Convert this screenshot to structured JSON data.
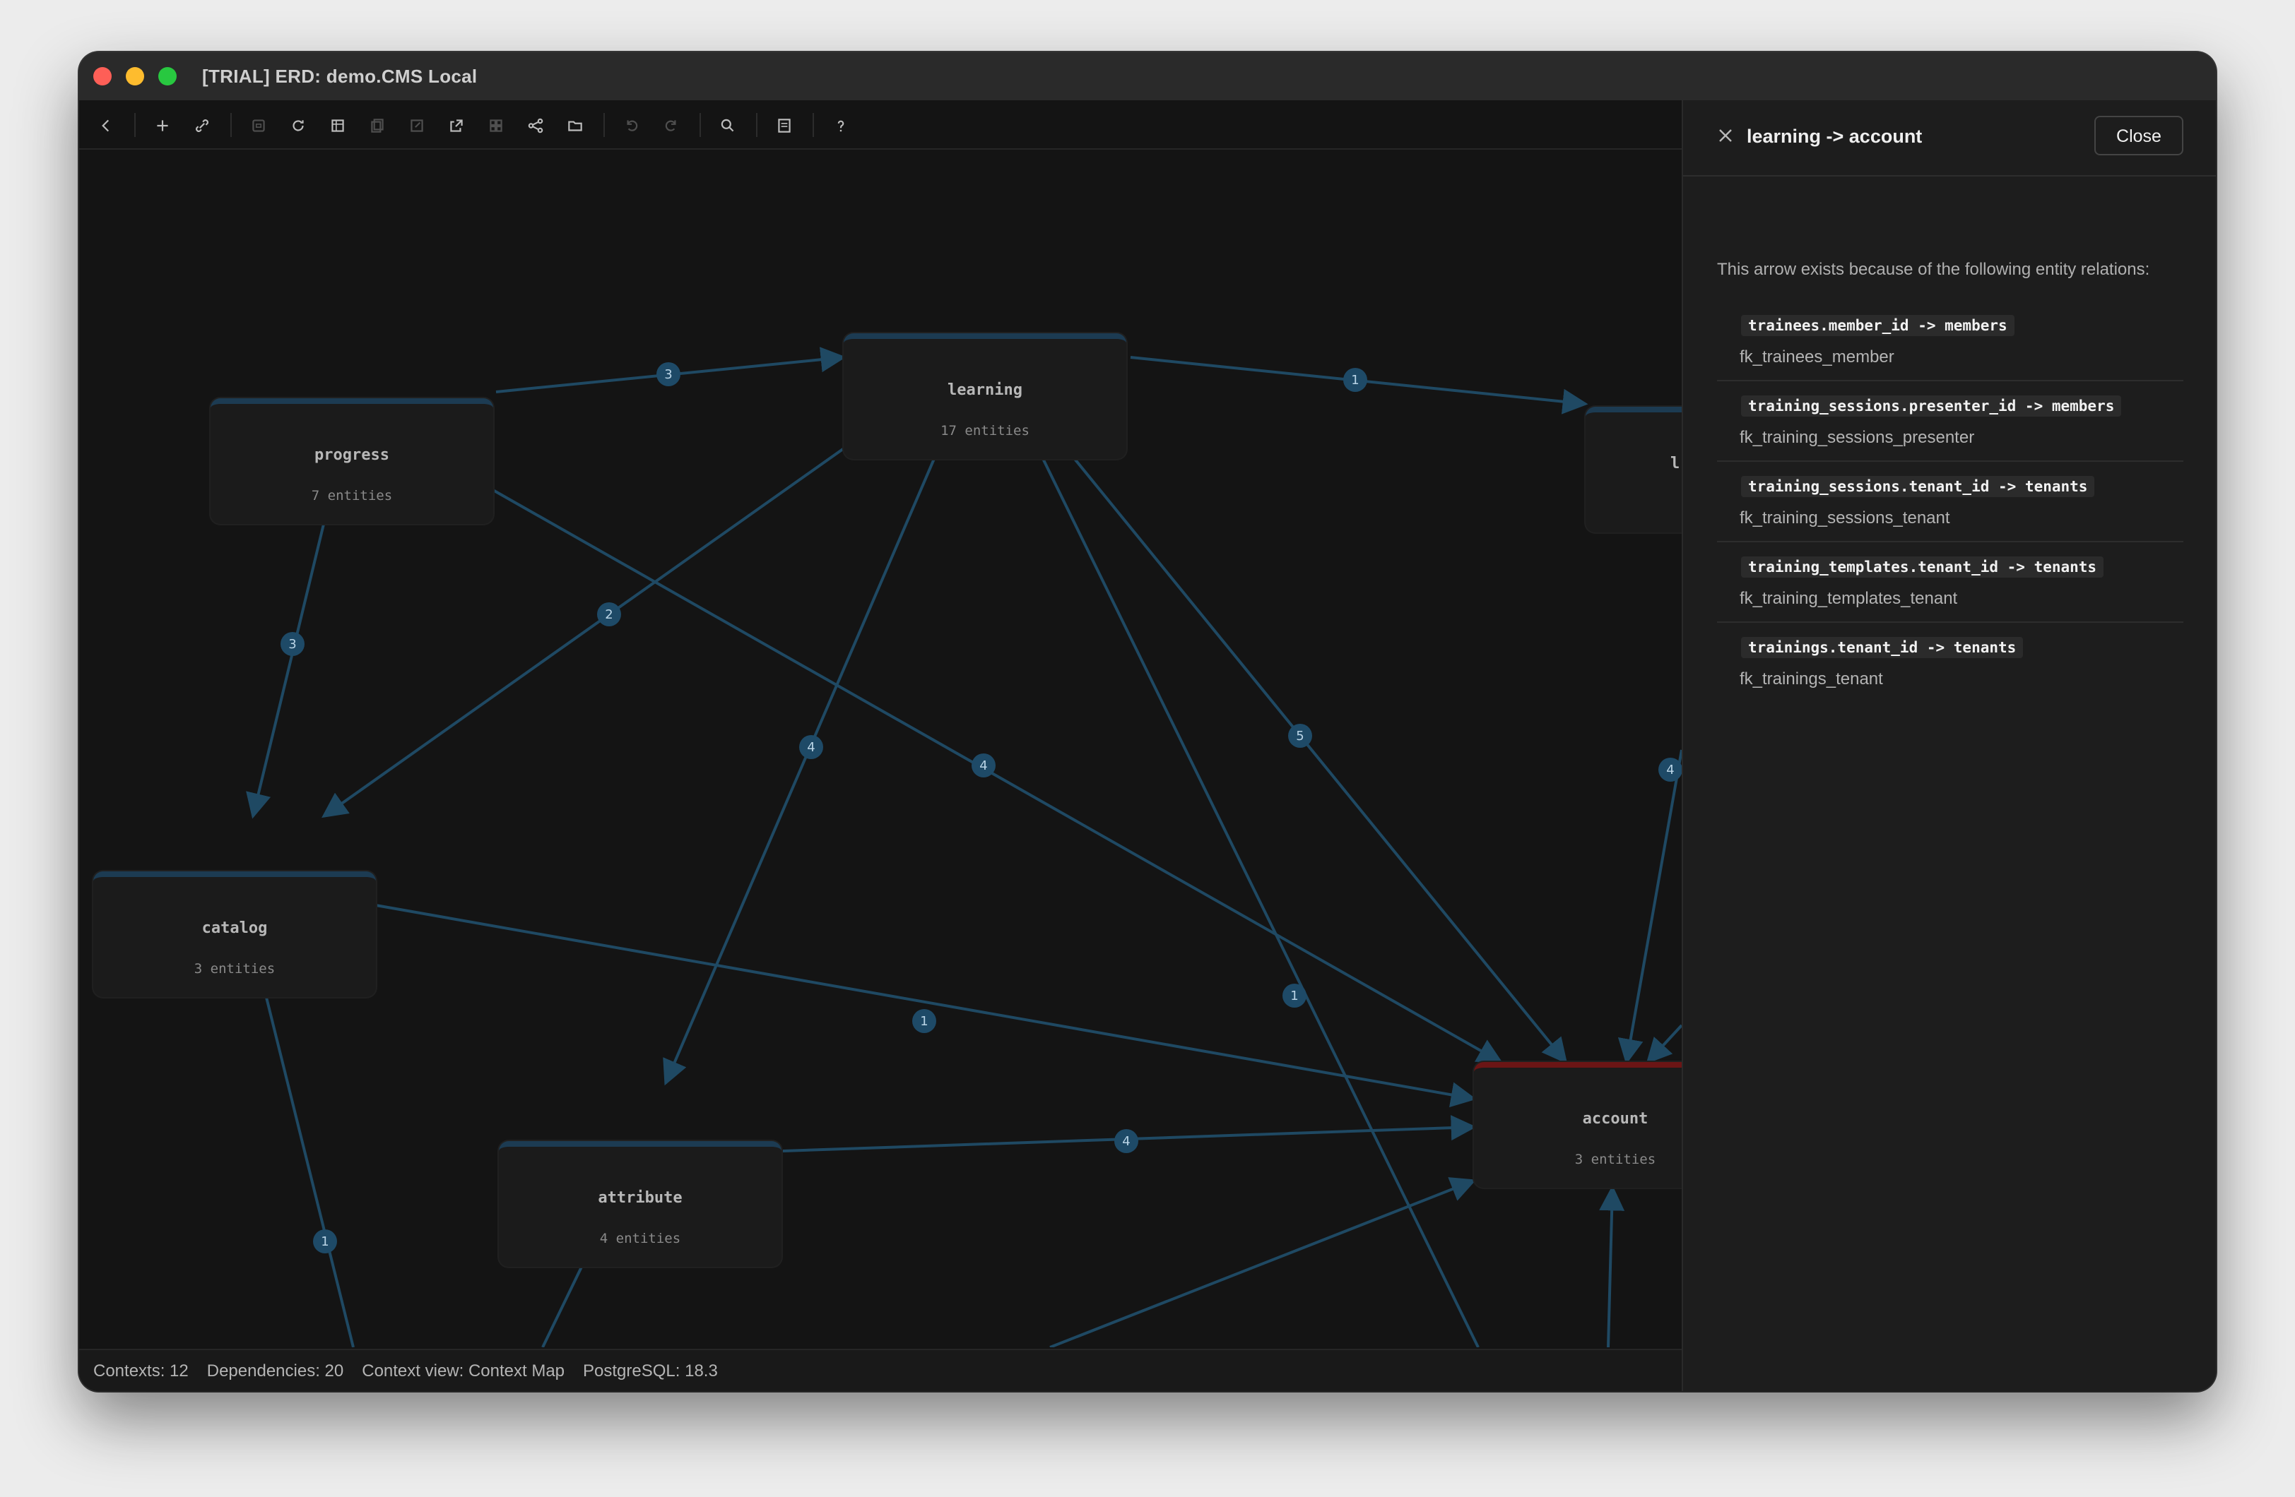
{
  "window": {
    "title": "[TRIAL] ERD: demo.CMS Local"
  },
  "toolbar": {
    "buttons": [
      {
        "name": "back-icon"
      },
      {
        "name": "add-icon"
      },
      {
        "name": "link-icon"
      },
      {
        "name": "save-icon"
      },
      {
        "name": "refresh-icon"
      },
      {
        "name": "layout-icon"
      },
      {
        "name": "copy-icon"
      },
      {
        "name": "edit-icon"
      },
      {
        "name": "export-icon"
      },
      {
        "name": "grid-icon"
      },
      {
        "name": "share-icon"
      },
      {
        "name": "folder-icon"
      },
      {
        "name": "undo-icon"
      },
      {
        "name": "redo-icon"
      },
      {
        "name": "search-icon"
      },
      {
        "name": "note-icon"
      },
      {
        "name": "help-icon"
      }
    ]
  },
  "diagram": {
    "nodes": [
      {
        "id": "progress",
        "name": "progress",
        "count": "7 entities"
      },
      {
        "id": "learning",
        "name": "learning",
        "count": "17 entities"
      },
      {
        "id": "partial",
        "name": "l",
        "count": ""
      },
      {
        "id": "catalog",
        "name": "catalog",
        "count": "3 entities"
      },
      {
        "id": "attribute",
        "name": "attribute",
        "count": "4 entities"
      },
      {
        "id": "account",
        "name": "account",
        "count": "3 entities",
        "highlighted": true
      }
    ],
    "edge_badges": [
      "3",
      "1",
      "3",
      "2",
      "4",
      "4",
      "5",
      "4",
      "1",
      "1",
      "4",
      "1"
    ],
    "edge_color": "#1f4963",
    "badge_color": "#1e4a67",
    "highlight_color": "#6b1515"
  },
  "statusbar": {
    "contexts": "Contexts: 12",
    "dependencies": "Dependencies: 20",
    "context_view": "Context view: Context Map",
    "postgres": "PostgreSQL: 18.3"
  },
  "panel": {
    "title": "learning -> account",
    "close_label": "Close",
    "intro": "This arrow exists because of the following entity relations:",
    "relations": [
      {
        "code": "trainees.member_id -> members",
        "name": "fk_trainees_member"
      },
      {
        "code": "training_sessions.presenter_id -> members",
        "name": "fk_training_sessions_presenter"
      },
      {
        "code": "training_sessions.tenant_id -> tenants",
        "name": "fk_training_sessions_tenant"
      },
      {
        "code": "training_templates.tenant_id -> tenants",
        "name": "fk_training_templates_tenant"
      },
      {
        "code": "trainings.tenant_id -> tenants",
        "name": "fk_trainings_tenant"
      }
    ]
  }
}
